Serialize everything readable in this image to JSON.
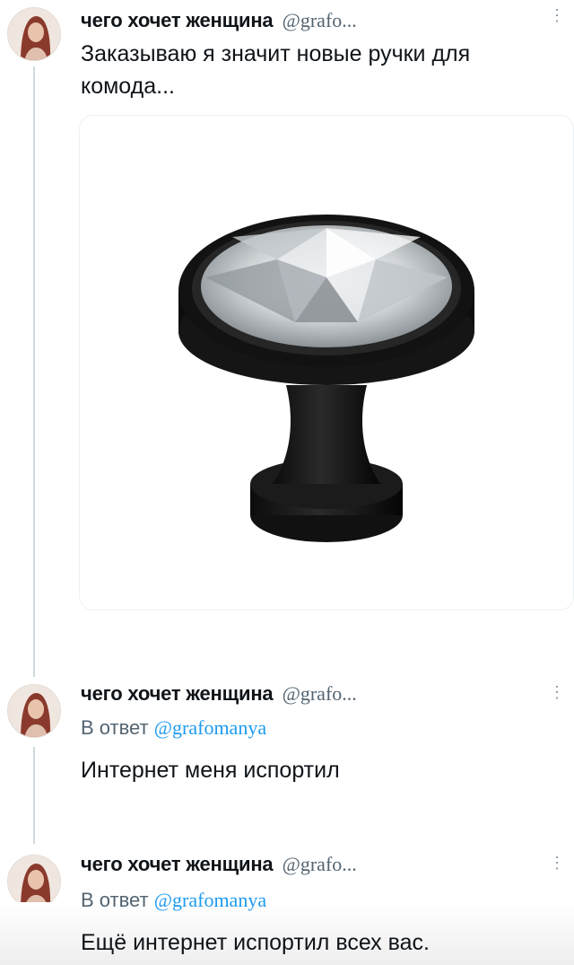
{
  "tweets": [
    {
      "name": "чего хочет женщина",
      "handle": "@grafo...",
      "text": "Заказываю я значит новые ручки для комода...",
      "has_media": true,
      "media_icon": "drawer-knob-image"
    },
    {
      "name": "чего хочет женщина",
      "handle": "@grafo...",
      "reply_prefix": "В ответ",
      "reply_handle": "@grafomanya",
      "text": "Интернет меня испортил"
    },
    {
      "name": "чего хочет женщина",
      "handle": "@grafo...",
      "reply_prefix": "В ответ",
      "reply_handle": "@grafomanya",
      "text": "Ещё интернет испортил всех вас."
    }
  ],
  "icons": {
    "more": "more-options-icon",
    "avatar": "avatar"
  },
  "colors": {
    "handle": "#536471",
    "mention": "#1d9bf0",
    "thread_line": "#cfd9de"
  }
}
